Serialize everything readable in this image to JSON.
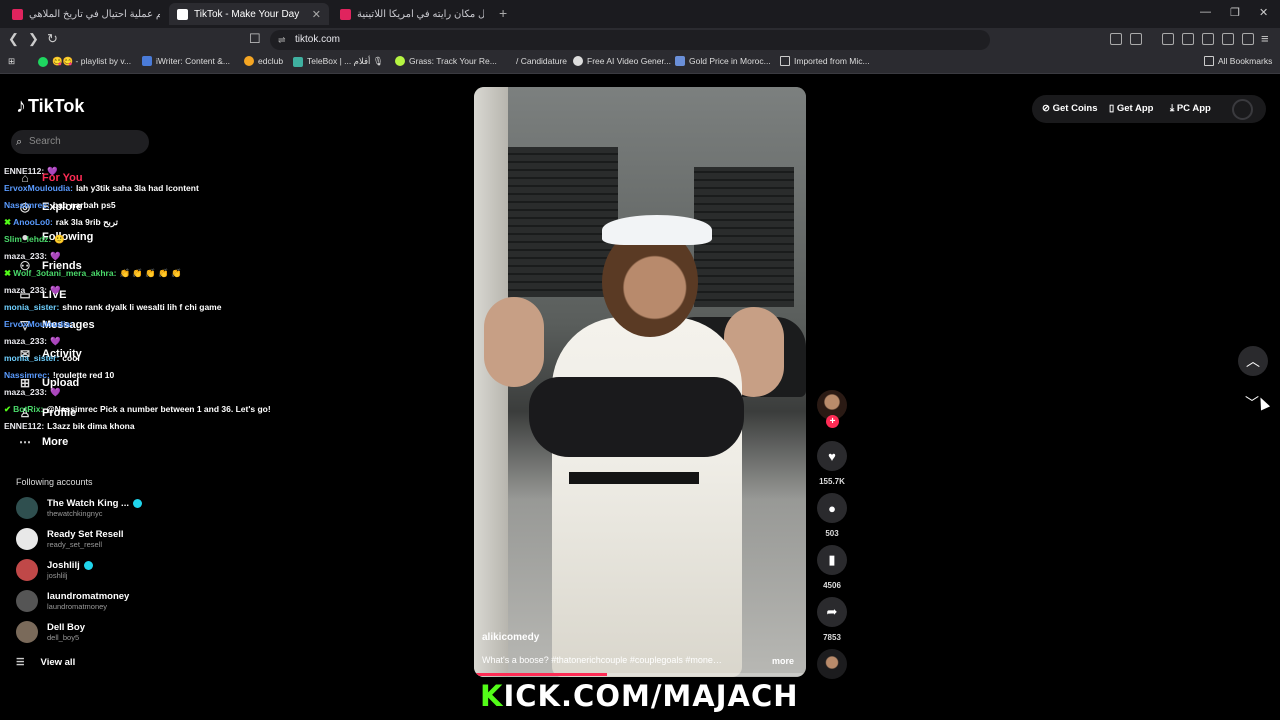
{
  "browser": {
    "tabs": [
      {
        "title": "اضخم عملية احتيال في تاريخ الملاهي",
        "kind": "youtube",
        "active": false
      },
      {
        "title": "TikTok - Make Your Day",
        "kind": "tiktok",
        "active": true
      },
      {
        "title": "أجمل مكان رأيته في أمريكا اللاتينية 🇻🇪",
        "kind": "youtube",
        "active": false
      }
    ],
    "new_tab": "+",
    "url": "tiktok.com",
    "bookmarks": [
      {
        "label": "😋😋 - playlist by v...",
        "color": "#1ed760"
      },
      {
        "label": "iWriter: Content &...",
        "color": "#4a7bd8"
      },
      {
        "label": "edclub",
        "color": "#f5a623"
      },
      {
        "label": "TeleBox | ... أفلام 🎙",
        "color": "#3fb0a0"
      },
      {
        "label": "Grass: Track Your Re...",
        "color": "#b6f542"
      },
      {
        "label": "/ Candidature",
        "color": "#2b2b30"
      },
      {
        "label": "Free AI Video Gener...",
        "color": "#dddddd"
      },
      {
        "label": "Gold Price in Moroc...",
        "color": "#6a8fd8"
      },
      {
        "label": "Imported from Mic...",
        "color": "#2b2b30"
      },
      {
        "label": "All Bookmarks",
        "color": "#2b2b30"
      }
    ]
  },
  "sidebar": {
    "logo": "TikTok",
    "search_placeholder": "Search",
    "nav": [
      {
        "label": "For You",
        "icon": "home-icon",
        "active": true
      },
      {
        "label": "Explore",
        "icon": "compass-icon"
      },
      {
        "label": "Following",
        "icon": "following-icon"
      },
      {
        "label": "Friends",
        "icon": "friends-icon"
      },
      {
        "label": "LIVE",
        "icon": "live-icon"
      },
      {
        "label": "Messages",
        "icon": "messages-icon"
      },
      {
        "label": "Activity",
        "icon": "activity-icon"
      },
      {
        "label": "Upload",
        "icon": "upload-icon"
      },
      {
        "label": "Profile",
        "icon": "profile-icon"
      },
      {
        "label": "More",
        "icon": "more-icon"
      }
    ],
    "following_header": "Following accounts",
    "accounts": [
      {
        "name": "The Watch King ...",
        "handle": "thewatchkingnyc",
        "verified": true,
        "color": "#2f4f4f"
      },
      {
        "name": "Ready Set Resell",
        "handle": "ready_set_resell",
        "verified": false,
        "color": "#e8e8e8"
      },
      {
        "name": "Joshlilj",
        "handle": "joshlilj",
        "verified": true,
        "color": "#c04848"
      },
      {
        "name": "laundromatmoney",
        "handle": "laundromatmoney",
        "verified": false,
        "color": "#555555"
      },
      {
        "name": "Dell Boy",
        "handle": "dell_boy5",
        "verified": false,
        "color": "#7a6a5a"
      }
    ],
    "view_all": "View all"
  },
  "chat": [
    {
      "user": "ENNE112:",
      "msg": "💜",
      "ucolor": "u3"
    },
    {
      "user": "ErvoxMouloudia:",
      "msg": "lah y3tik saha 3la had lcontent",
      "ucolor": "u1"
    },
    {
      "user": "Nassimrec:",
      "msg": "bab narbah ps5",
      "ucolor": "u1"
    },
    {
      "user": "AnooLo0:",
      "msg": "rak 3la 9rib تربح",
      "ucolor": "u1",
      "badge": "✖"
    },
    {
      "user": "Slim_lehdz:",
      "msg": "🙂",
      "ucolor": "u2"
    },
    {
      "user": "maza_233:",
      "msg": "💜",
      "ucolor": "u3"
    },
    {
      "user": "Wolf_3otani_mera_akhra:",
      "msg": "👏 👏 👏 👏 👏",
      "ucolor": "u2",
      "badge": "✖"
    },
    {
      "user": "maza_233:",
      "msg": "💜",
      "ucolor": "u3"
    },
    {
      "user": "monia_sister:",
      "msg": "shno rank dyalk li wesalti lih f chi game",
      "ucolor": "u4"
    },
    {
      "user": "ErvoxMouloudia:",
      "msg": "",
      "ucolor": "u1"
    },
    {
      "user": "maza_233:",
      "msg": "💜",
      "ucolor": "u3"
    },
    {
      "user": "monia_sister:",
      "msg": "cool",
      "ucolor": "u4"
    },
    {
      "user": "Nassimrec:",
      "msg": "!roulette red 10",
      "ucolor": "u1"
    },
    {
      "user": "maza_233:",
      "msg": "💜",
      "ucolor": "u3"
    },
    {
      "user": "BotRix:",
      "msg": "@Nassimrec Pick a number between 1 and 36. Let's go!",
      "ucolor": "u2",
      "badge": "✔"
    },
    {
      "user": "ENNE112:",
      "msg": "L3azz bik dima khona",
      "ucolor": "u3"
    }
  ],
  "topbar": {
    "get_coins": "Get Coins",
    "get_app": "Get App",
    "pc_app": "PC App"
  },
  "video": {
    "username": "alikicomedy",
    "caption": "What's a boose? #thatonerichcouple #couplegoals #money ...",
    "more": "more",
    "progress": 0.4
  },
  "actions": {
    "likes": "155.7K",
    "comments": "503",
    "saves": "4506",
    "shares": "7853"
  },
  "banner": {
    "k": "K",
    "rest": "ICK.COM/MAJACH"
  },
  "colors": {
    "accent": "#fe2c55",
    "kick_green": "#53fc18",
    "verified": "#20d5ec"
  }
}
